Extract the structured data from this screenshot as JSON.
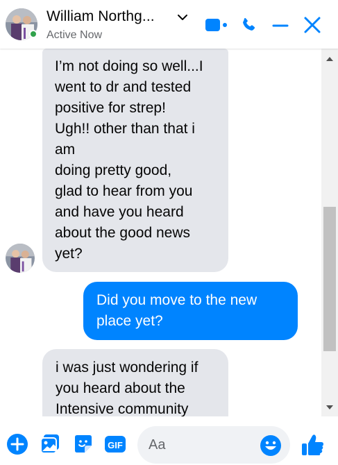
{
  "header": {
    "contact_name": "William Northg...",
    "status": "Active Now"
  },
  "messages": [
    {
      "direction": "incoming",
      "lines": [
        "I’m not doing so well...I",
        "went to dr and tested",
        "positive for strep!",
        "Ugh!! other than that i",
        "am",
        "doing pretty good,",
        "glad to hear from you",
        "and have you heard",
        "about the good news",
        "yet?"
      ]
    },
    {
      "direction": "outgoing",
      "lines": [
        "Did you move to the new",
        "place yet?"
      ]
    },
    {
      "direction": "incoming",
      "lines": [
        "i was just wondering if",
        "you heard about the",
        "Intensive community"
      ]
    }
  ],
  "composer": {
    "placeholder": "Aa"
  },
  "icons": {
    "video_call": "video-camera-icon",
    "audio_call": "phone-icon",
    "minimize": "minimize-icon",
    "close": "close-icon",
    "more_actions": "plus-circle-icon",
    "photo": "image-icon",
    "sticker": "sticker-icon",
    "gif": "gif-icon",
    "emoji": "emoji-icon",
    "like": "thumbs-up-icon"
  },
  "colors": {
    "accent": "#0084ff",
    "incoming_bubble": "#e4e6eb",
    "online": "#31a24c"
  }
}
